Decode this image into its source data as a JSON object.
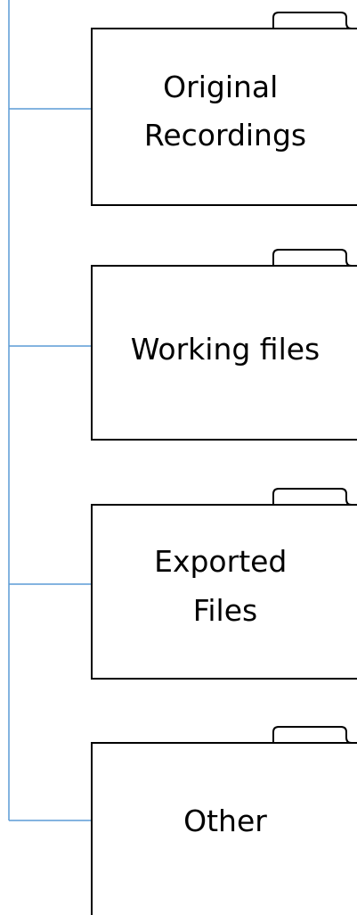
{
  "colors": {
    "connector": "#5B9BD5",
    "folder_outline": "#000000",
    "folder_fill": "#ffffff",
    "text": "#000000"
  },
  "folders": [
    {
      "lines": [
        "Original",
        "Recordings"
      ]
    },
    {
      "lines": [
        "Working files"
      ]
    },
    {
      "lines": [
        "Exported",
        "Files"
      ]
    },
    {
      "lines": [
        "Other"
      ]
    }
  ]
}
